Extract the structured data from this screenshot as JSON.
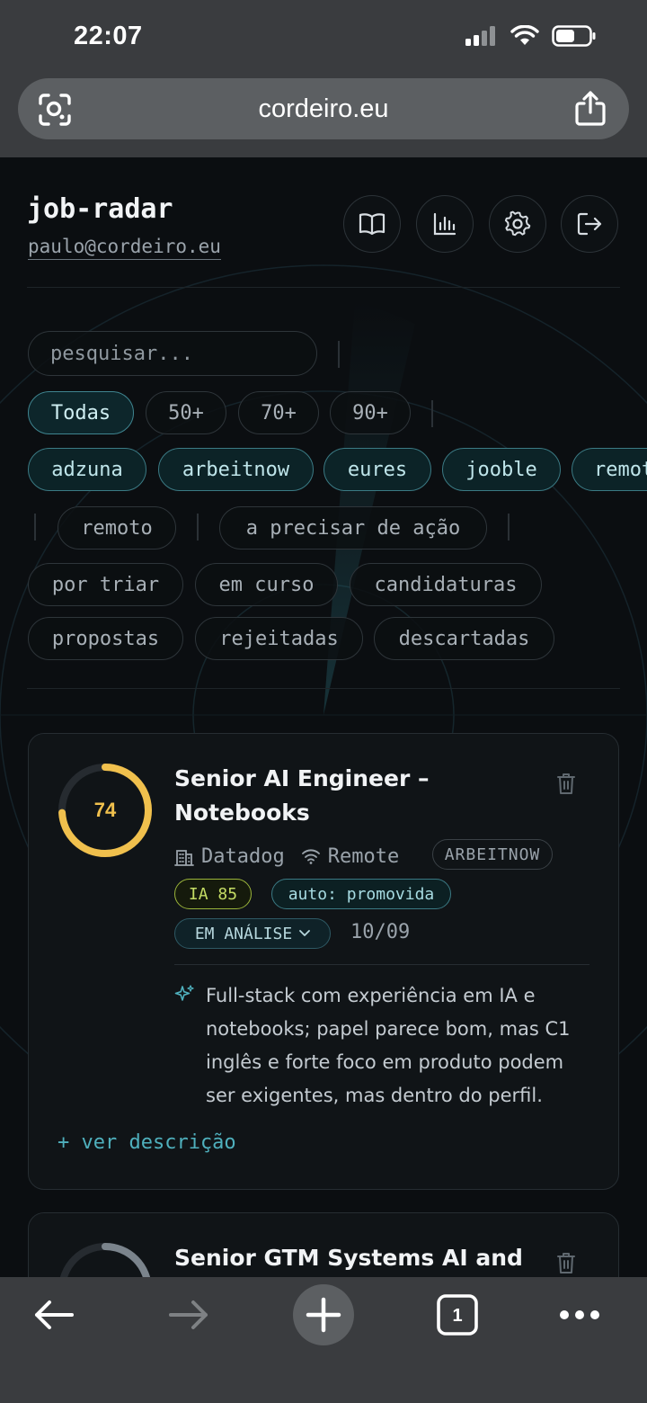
{
  "status_bar": {
    "time": "22:07"
  },
  "browser": {
    "url": "cordeiro.eu",
    "tab_count": "1",
    "icons": {
      "lens": "lens-icon",
      "share": "share-icon",
      "back": "back-arrow-icon",
      "forward": "forward-arrow-icon",
      "new_tab": "plus-icon",
      "tabs": "tabs-icon",
      "more": "more-icon"
    }
  },
  "app": {
    "title": "job-radar",
    "user_email": "paulo@cordeiro.eu",
    "header_actions": [
      "book-icon",
      "chart-icon",
      "gear-icon",
      "logout-icon"
    ]
  },
  "filters": {
    "search_placeholder": "pesquisar...",
    "score_chips": [
      "Todas",
      "50+",
      "70+",
      "90+"
    ],
    "source_chips": [
      "adzuna",
      "arbeitnow",
      "eures",
      "jooble",
      "remot"
    ],
    "remote_chip": "remoto",
    "action_chip": "a precisar de ação",
    "status_chips_row1": [
      "por triar",
      "em curso",
      "candidaturas"
    ],
    "status_chips_row2": [
      "propostas",
      "rejeitadas",
      "descartadas"
    ]
  },
  "jobs": [
    {
      "score": "74",
      "score_fraction": 0.74,
      "title": "Senior AI Engineer – Notebooks",
      "company": "Datadog",
      "location": "Remote",
      "source": "ARBEITNOW",
      "ia_badge": "IA 85",
      "auto_badge": "auto: promovida",
      "status": "EM ANÁLISE",
      "date": "10/09",
      "summary": "Full-stack com experiência em IA e notebooks; papel parece bom, mas C1 inglês e forte foco em produto podem ser exigentes, mas dentro do perfil.",
      "more_link": "+ ver descrição"
    },
    {
      "score_fraction": 0.4,
      "title": "Senior GTM Systems AI and"
    }
  ],
  "colors": {
    "accent": "#4fb0bd",
    "score_high": "#f0c04d",
    "ia_badge": "#c4dc64",
    "background": "#0b0e11"
  }
}
